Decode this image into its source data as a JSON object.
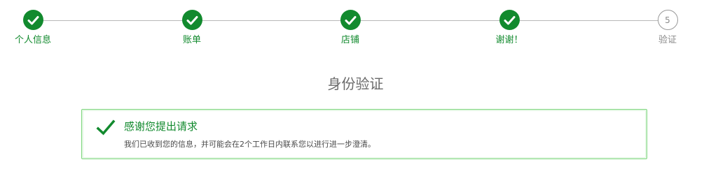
{
  "colors": {
    "success": "#128a2e",
    "pending": "#8a8a8a",
    "line": "#b8b8b8",
    "alert_border": "#7fd67f"
  },
  "steps": [
    {
      "label": "个人信息",
      "status": "done",
      "icon": "check-icon"
    },
    {
      "label": "账单",
      "status": "done",
      "icon": "check-icon"
    },
    {
      "label": "店铺",
      "status": "done",
      "icon": "check-icon"
    },
    {
      "label": "谢谢！",
      "status": "done",
      "icon": "check-icon"
    },
    {
      "label": "验证",
      "status": "pending",
      "number": "5"
    }
  ],
  "page": {
    "title": "身份验证"
  },
  "alert": {
    "icon": "check-icon",
    "title": "感谢您提出请求",
    "message": "我们已收到您的信息，并可能会在2个工作日内联系您以进行进一步澄清。"
  }
}
